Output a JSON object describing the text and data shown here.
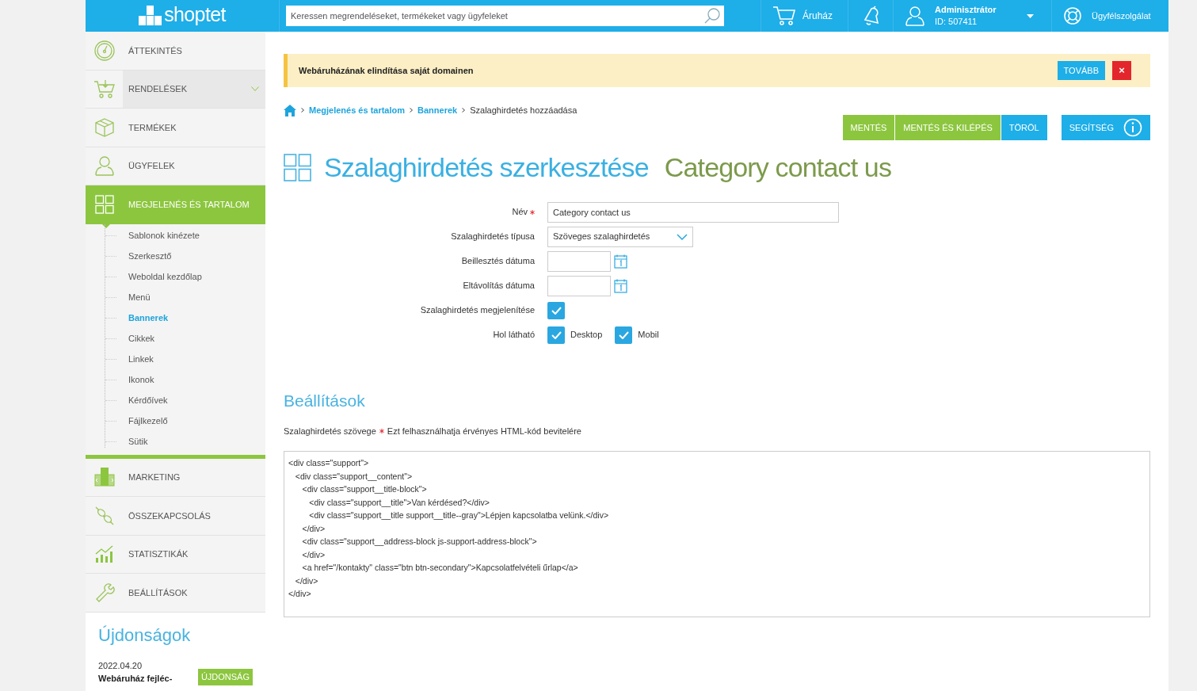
{
  "topbar": {
    "logo": "shoptet",
    "search": {
      "placeholder": "Keressen megrendeléseket, termékeket vagy ügyfeleket"
    },
    "store": "Áruház",
    "user": {
      "name": "Adminisztrátor",
      "id": "ID: 507411"
    },
    "support": "Ügyfélszolgálat"
  },
  "sidebar": {
    "items": [
      {
        "label": "ÁTTEKINTÉS",
        "selected": false,
        "hovered": false
      },
      {
        "label": "RENDELÉSEK",
        "selected": false,
        "hovered": true,
        "kind": "submenu"
      },
      {
        "label": "TERMÉKEK",
        "selected": false,
        "hovered": false
      },
      {
        "label": "ÜGYFELEK",
        "selected": false,
        "hovered": false
      },
      {
        "label": "MEGJELENÉS ÉS TARTALOM",
        "selected": true,
        "hovered": false,
        "children": [
          {
            "label": "Sablonok kinézete",
            "selected": false
          },
          {
            "label": "Szerkesztő",
            "selected": false
          },
          {
            "label": "Weboldal kezdőlap",
            "selected": false
          },
          {
            "label": "Menü",
            "selected": false
          },
          {
            "label": "Bannerek",
            "selected": true
          },
          {
            "label": "Cikkek",
            "selected": false
          },
          {
            "label": "Linkek",
            "selected": false
          },
          {
            "label": "Ikonok",
            "selected": false
          },
          {
            "label": "Kérdőívek",
            "selected": false
          },
          {
            "label": "Fájlkezelő",
            "selected": false
          },
          {
            "label": "Sütik",
            "selected": false
          }
        ]
      },
      {
        "label": "MARKETING",
        "selected": false,
        "hovered": false
      },
      {
        "label": "ÖSSZEKAPCSOLÁS",
        "selected": false,
        "hovered": false
      },
      {
        "label": "STATISZTIKÁK",
        "selected": false,
        "hovered": false
      },
      {
        "label": "BEÁLLÍTÁSOK",
        "selected": false,
        "hovered": false
      }
    ],
    "news": {
      "title": "Újdonságok",
      "items": [
        {
          "date": "2022.04.20",
          "title": "Webáruház fejléc-",
          "badge": "ÚJDONSÁG"
        }
      ]
    }
  },
  "notice": {
    "text": "Webáruházának elindítása saját domainen",
    "button": "TOVÁBB",
    "close": "×"
  },
  "breadcrumb": [
    {
      "kind": "home"
    },
    {
      "kind": "link",
      "label": "Megjelenés és tartalom"
    },
    {
      "kind": "link",
      "label": "Bannerek"
    },
    {
      "kind": "current",
      "label": "Szalaghirdetés hozzáadása"
    }
  ],
  "actions": [
    {
      "label": "MENTÉS",
      "kind": "primary"
    },
    {
      "label": "MENTÉS ÉS KILÉPÉS",
      "kind": "primary"
    },
    {
      "label": "TÖRÖL",
      "kind": "secondary"
    },
    {
      "label": "SEGÍTSÉG",
      "kind": "help"
    }
  ],
  "heading": {
    "title": "Szalaghirdetés szerkesztése",
    "subtitle": "Category contact us"
  },
  "form": {
    "fields": [
      {
        "kind": "text",
        "label": "Név",
        "required": true,
        "value": "Category contact us"
      },
      {
        "kind": "select",
        "label": "Szalaghirdetés típusa",
        "required": false,
        "value": "Szöveges szalaghirdetés"
      },
      {
        "kind": "date",
        "label": "Beillesztés dátuma",
        "required": false
      },
      {
        "kind": "date",
        "label": "Eltávolítás dátuma",
        "required": false
      },
      {
        "kind": "checkbox",
        "label": "Szalaghirdetés megjelenítése",
        "required": false,
        "checked": true
      },
      {
        "kind": "checkgroup",
        "label": "Hol látható",
        "required": false,
        "options": [
          {
            "label": "Desktop",
            "checked": true
          },
          {
            "label": "Mobil",
            "checked": true
          }
        ]
      }
    ]
  },
  "settings": {
    "title": "Beállítások",
    "field_label": "Szalaghirdetés szövege",
    "required": true,
    "hint": "Ezt felhasználhatja érvényes HTML-kód bevitelére",
    "code": "<div class=\"support\">\n   <div class=\"support__content\">\n      <div class=\"support__title-block\">\n         <div class=\"support__title\">Van kérdésed?</div>\n         <div class=\"support__title support__title--gray\">Lépjen kapcsolatba velünk.</div>\n      </div>\n      <div class=\"support__address-block js-support-address-block\">\n      </div>\n      <a href=\"/kontakty\" class=\"btn btn-secondary\">Kapcsolatfelvételi űrlap</a>\n   </div>\n</div>"
  }
}
